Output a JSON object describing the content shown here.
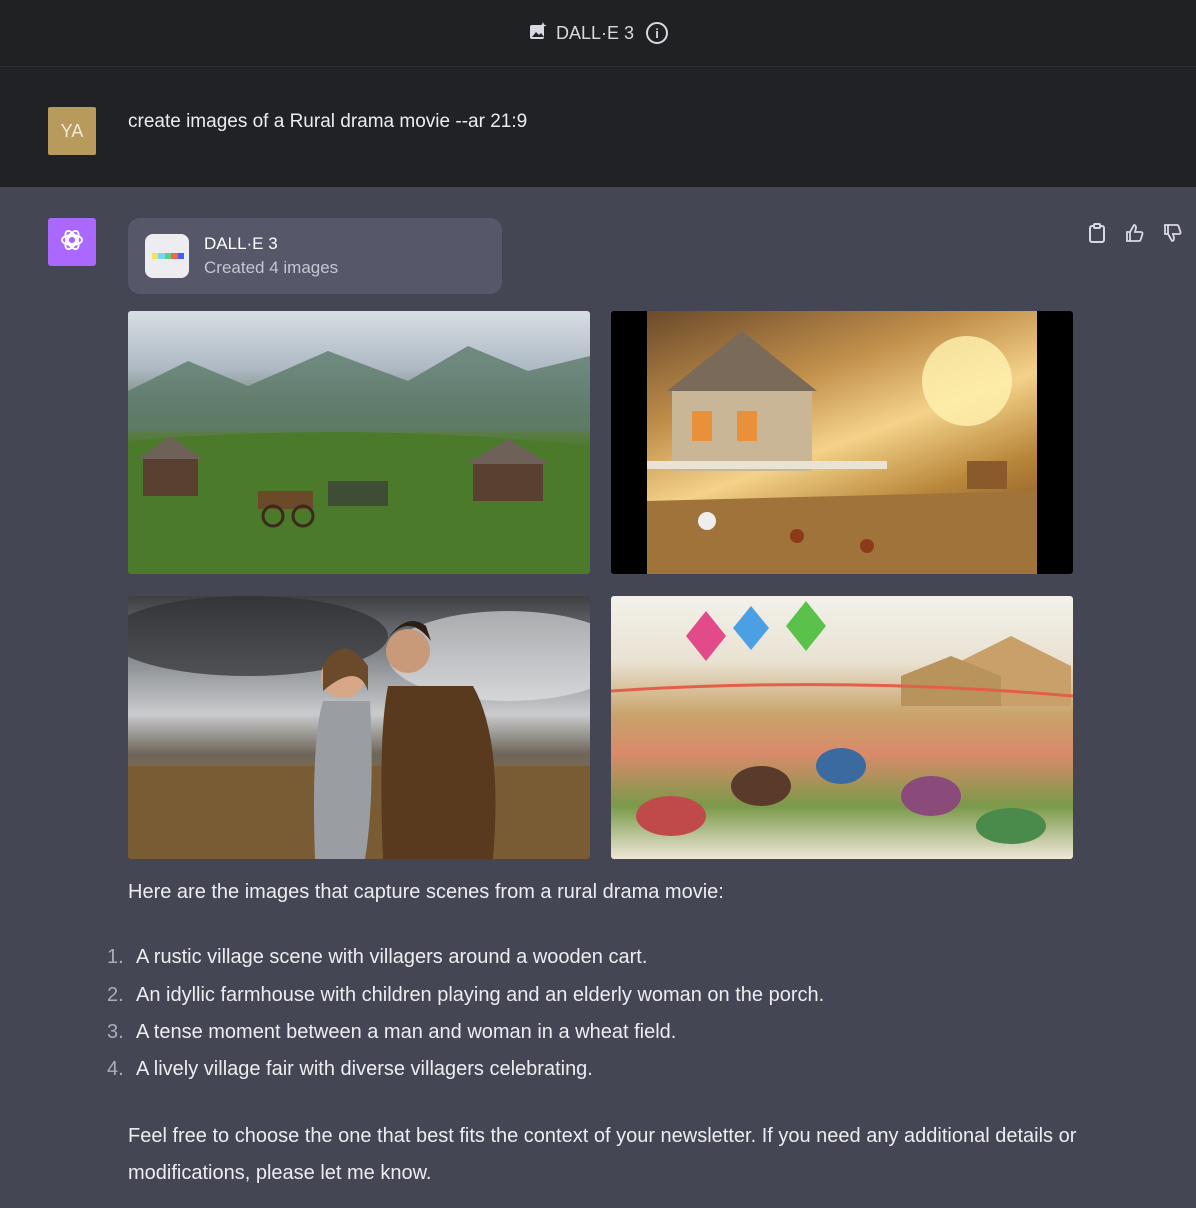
{
  "header": {
    "model_name": "DALL·E 3"
  },
  "user": {
    "avatar_initials": "YA",
    "message": "create images of a Rural drama movie --ar 21:9"
  },
  "assistant": {
    "tool": {
      "name": "DALL·E 3",
      "status": "Created 4 images"
    },
    "intro": "Here are the images that capture scenes from a rural drama movie:",
    "items": [
      {
        "num": "1.",
        "text": "A rustic village scene with villagers around a wooden cart."
      },
      {
        "num": "2.",
        "text": "An idyllic farmhouse with children playing and an elderly woman on the porch."
      },
      {
        "num": "3.",
        "text": "A tense moment between a man and woman in a wheat field."
      },
      {
        "num": "4.",
        "text": "A lively village fair with diverse villagers celebrating."
      }
    ],
    "closing": "Feel free to choose the one that best fits the context of your newsletter. If you need any additional details or modifications, please let me know."
  },
  "colors": {
    "background": "#444654",
    "user_row": "#212226",
    "topbar": "#202123",
    "bot_avatar": "#ab68ff",
    "user_avatar": "#b89a5d"
  }
}
